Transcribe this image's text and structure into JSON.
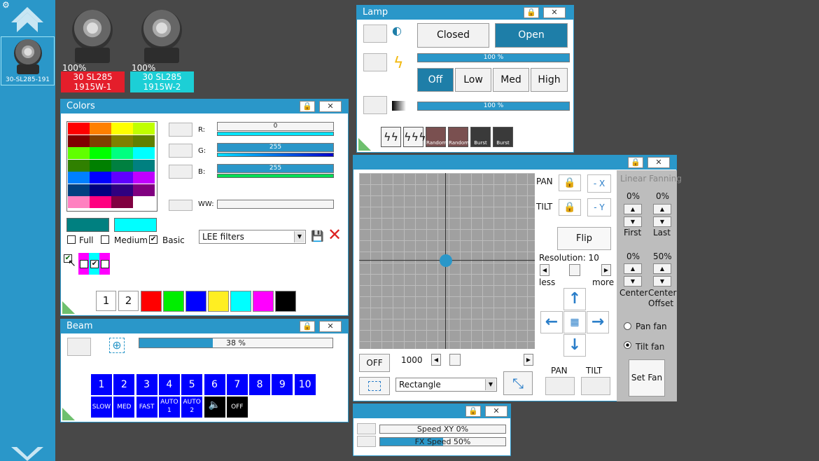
{
  "sidebar": {
    "fixture_label": "30-SL285-191"
  },
  "fixtures": [
    {
      "percent": "100%",
      "line1": "30 SL285",
      "line2": "1915W-1",
      "color": "#e41e2b"
    },
    {
      "percent": "100%",
      "line1": "30 SL285",
      "line2": "1915W-2",
      "color": "#1ccfd6"
    }
  ],
  "lamp": {
    "title": "Lamp",
    "closed_label": "Closed",
    "open_label": "Open",
    "intensity_bar": "100 %",
    "off_label": "Off",
    "low_label": "Low",
    "med_label": "Med",
    "high_label": "High",
    "dimmer_bar": "100 %",
    "effects": [
      "",
      "",
      "Random",
      "Random",
      "Burst",
      "Burst"
    ]
  },
  "colors": {
    "title": "Colors",
    "r_label": "R:",
    "r_value": "0",
    "g_label": "G:",
    "g_value": "255",
    "b_label": "B:",
    "b_value": "255",
    "ww_label": "WW:",
    "full_label": "Full",
    "medium_label": "Medium",
    "basic_label": "Basic",
    "filter_select": "LEE filters",
    "preset_1": "1",
    "preset_2": "2",
    "palette": [
      [
        "#ff0000",
        "#ff8000",
        "#ffff00",
        "#c0ff00"
      ],
      [
        "#800000",
        "#804000",
        "#808000",
        "#608000"
      ],
      [
        "#60ff00",
        "#00ff00",
        "#00ff80",
        "#00ffff"
      ],
      [
        "#308000",
        "#008000",
        "#008040",
        "#008080"
      ],
      [
        "#0080ff",
        "#0000ff",
        "#6000ff",
        "#c000ff"
      ],
      [
        "#004080",
        "#000080",
        "#300080",
        "#800080"
      ],
      [
        "#ff80c0",
        "#ff0080",
        "#800040",
        "#ffffff"
      ]
    ],
    "swatches": [
      "#ff0000",
      "#00ee00",
      "#0000ff",
      "#ffee22",
      "#00ffff",
      "#ff00ff",
      "#000000"
    ],
    "current_color_left": "#008080",
    "current_color_right": "#00ffff"
  },
  "beam": {
    "title": "Beam",
    "zoom_bar": "38 %",
    "zoom_fraction": 0.38,
    "numbers": [
      "1",
      "2",
      "3",
      "4",
      "5",
      "6",
      "7",
      "8",
      "9",
      "10"
    ],
    "modes": [
      "SLOW",
      "MED",
      "FAST",
      "AUTO 1",
      "AUTO 2",
      "",
      "OFF"
    ]
  },
  "position": {
    "pan_label": "PAN",
    "tilt_label": "TILT",
    "minus_x": "- X",
    "minus_y": "- Y",
    "flip_label": "Flip",
    "resolution_label": "Resolution: 10",
    "less_label": "less",
    "more_label": "more",
    "off_label": "OFF",
    "speed_value": "1000",
    "shape_select": "Rectangle",
    "pan_bottom_label": "PAN",
    "tilt_bottom_label": "TILT",
    "fanning": {
      "title": "Linear Fanning",
      "first_value": "0%",
      "last_value": "0%",
      "first_label": "First",
      "last_label": "Last",
      "center_value": "0%",
      "offset_value": "50%",
      "center_label": "Center",
      "offset_label": "Center Offset",
      "pan_fan_label": "Pan fan",
      "tilt_fan_label": "Tilt fan",
      "set_fan_label": "Set Fan"
    }
  },
  "speed": {
    "speed_xy": "Speed XY    0%",
    "fx_speed": "FX Speed      50%",
    "fx_fraction": 0.5
  }
}
